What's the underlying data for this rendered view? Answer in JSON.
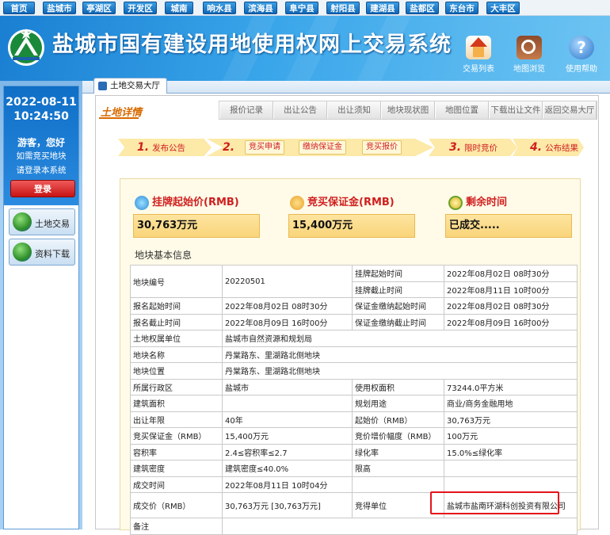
{
  "topnav": [
    "首页",
    "盐城市",
    "亭湖区",
    "开发区",
    "城南",
    "响水县",
    "滨海县",
    "阜宁县",
    "射阳县",
    "建湖县",
    "盐都区",
    "东台市",
    "大丰区"
  ],
  "banner": {
    "title": "盐城市国有建设用地使用权网上交易系统",
    "icons": [
      {
        "label": "交易列表",
        "icon": "house-icon"
      },
      {
        "label": "地图浏览",
        "icon": "map-icon"
      },
      {
        "label": "使用帮助",
        "icon": "help-icon"
      }
    ]
  },
  "sidebar": {
    "date": "2022-08-11",
    "time": "10:24:50",
    "greeting": "游客，您好",
    "buy_hint": "如需竞买地块",
    "login_hint": "请登录本系统",
    "login_label": "登录",
    "buttons": [
      {
        "label": "土地交易"
      },
      {
        "label": "资料下载"
      }
    ]
  },
  "tab": {
    "label": "土地交易大厅"
  },
  "detail": {
    "title": "土地详情",
    "subtabs": [
      "报价记录",
      "出让公告",
      "出让须知",
      "地块现状图",
      "地图位置",
      "下载出让文件",
      "返回交易大厅"
    ],
    "steps": [
      {
        "num": "1.",
        "label": "发布公告"
      },
      {
        "num": "2.",
        "sub": [
          "竞买申请",
          "缴纳保证金",
          "竞买报价"
        ]
      },
      {
        "num": "3.",
        "label": "限时竞价"
      },
      {
        "num": "4.",
        "label": "公布结果"
      }
    ],
    "summary": [
      {
        "head": "挂牌起始价(RMB)",
        "value": "30,763万元"
      },
      {
        "head": "竞买保证金(RMB)",
        "value": "15,400万元"
      },
      {
        "head": "剩余时间",
        "value": "已成交....."
      }
    ],
    "base_info_title": "地块基本信息",
    "table": {
      "land_no_label": "地块编号",
      "land_no": "20220501",
      "list_start_label": "挂牌起始时间",
      "list_start": "2022年08月02日 08时30分",
      "list_end_label": "挂牌截止时间",
      "list_end": "2022年08月11日 10时00分",
      "reg_start_label": "报名起始时间",
      "reg_start": "2022年08月02日 08时30分",
      "dep_start_label": "保证金缴纳起始时间",
      "dep_start": "2022年08月02日 08时30分",
      "reg_end_label": "报名截止时间",
      "reg_end": "2022年08月09日 16时00分",
      "dep_end_label": "保证金缴纳截止时间",
      "dep_end": "2022年08月09日 16时00分",
      "owner_label": "土地权属单位",
      "owner": "盐城市自然资源和规划局",
      "name_label": "地块名称",
      "name": "丹棠路东、里湖路北侧地块",
      "loc_label": "地块位置",
      "loc": "丹棠路东、里湖路北侧地块",
      "district_label": "所属行政区",
      "district": "盐城市",
      "area_label": "使用权面积",
      "area": "73244.0平方米",
      "build_area_label": "建筑面积",
      "build_area": "",
      "use_label": "规划用途",
      "use": "商业/商务金融用地",
      "term_label": "出让年限",
      "term": "40年",
      "start_price_label": "起始价（RMB）",
      "start_price": "30,763万元",
      "deposit_label": "竞买保证金（RMB）",
      "deposit": "15,400万元",
      "increment_label": "竞价增价幅度（RMB）",
      "increment": "100万元",
      "far_label": "容积率",
      "far": "2.4≤容积率≤2.7",
      "green_label": "绿化率",
      "green": "15.0%≤绿化率",
      "density_label": "建筑密度",
      "density": "建筑密度≤40.0%",
      "height_label": "限高",
      "height": "",
      "deal_time_label": "成交时间",
      "deal_time": "2022年08月11日 10时04分",
      "deal_price_label": "成交价（RMB）",
      "deal_price": "30,763万元 [30,763万元]",
      "winner_label": "竞得单位",
      "winner": "盐城市盐南环湖科创投资有限公司",
      "remark_label": "备注"
    }
  }
}
